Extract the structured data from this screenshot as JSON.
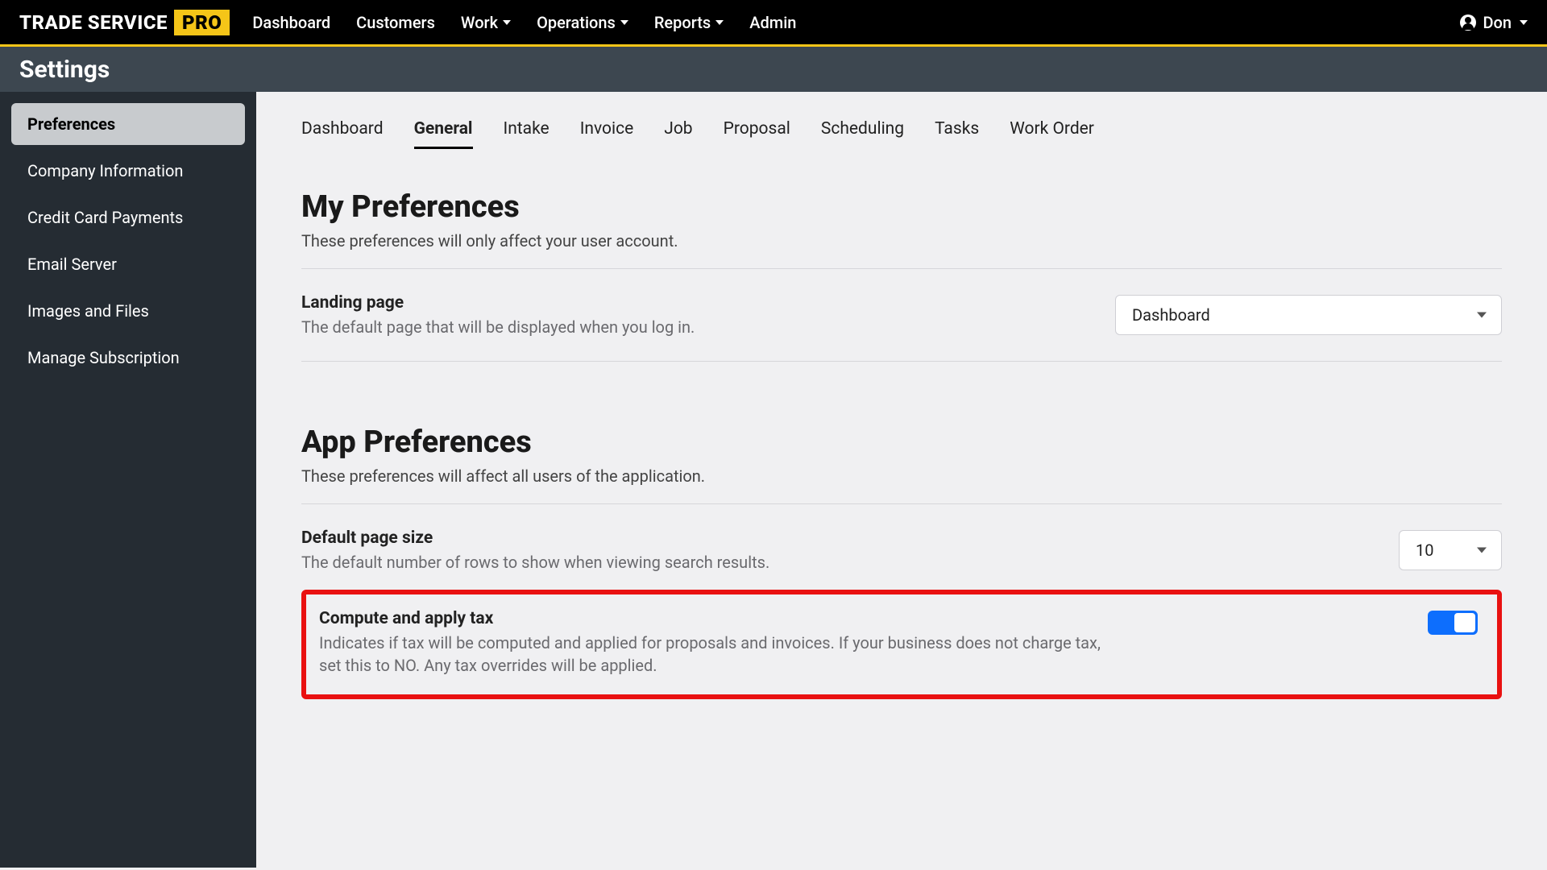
{
  "logo": {
    "text1": "TRADE SERVICE",
    "text2": "PRO"
  },
  "nav": {
    "items": [
      {
        "label": "Dashboard",
        "dropdown": false
      },
      {
        "label": "Customers",
        "dropdown": false
      },
      {
        "label": "Work",
        "dropdown": true
      },
      {
        "label": "Operations",
        "dropdown": true
      },
      {
        "label": "Reports",
        "dropdown": true
      },
      {
        "label": "Admin",
        "dropdown": false
      }
    ],
    "user": "Don"
  },
  "settings_header": "Settings",
  "sidebar": {
    "items": [
      {
        "label": "Preferences",
        "active": true
      },
      {
        "label": "Company Information",
        "active": false
      },
      {
        "label": "Credit Card Payments",
        "active": false
      },
      {
        "label": "Email Server",
        "active": false
      },
      {
        "label": "Images and Files",
        "active": false
      },
      {
        "label": "Manage Subscription",
        "active": false
      }
    ]
  },
  "tabs": [
    {
      "label": "Dashboard",
      "active": false
    },
    {
      "label": "General",
      "active": true
    },
    {
      "label": "Intake",
      "active": false
    },
    {
      "label": "Invoice",
      "active": false
    },
    {
      "label": "Job",
      "active": false
    },
    {
      "label": "Proposal",
      "active": false
    },
    {
      "label": "Scheduling",
      "active": false
    },
    {
      "label": "Tasks",
      "active": false
    },
    {
      "label": "Work Order",
      "active": false
    }
  ],
  "my_prefs": {
    "heading": "My Preferences",
    "sub": "These preferences will only affect your user account.",
    "landing": {
      "title": "Landing page",
      "desc": "The default page that will be displayed when you log in.",
      "value": "Dashboard"
    }
  },
  "app_prefs": {
    "heading": "App Preferences",
    "sub": "These preferences will affect all users of the application.",
    "page_size": {
      "title": "Default page size",
      "desc": "The default number of rows to show when viewing search results.",
      "value": "10"
    },
    "tax": {
      "title": "Compute and apply tax",
      "desc": "Indicates if tax will be computed and applied for proposals and invoices. If your business does not charge tax, set this to NO. Any tax overrides will be applied.",
      "enabled": true
    }
  }
}
